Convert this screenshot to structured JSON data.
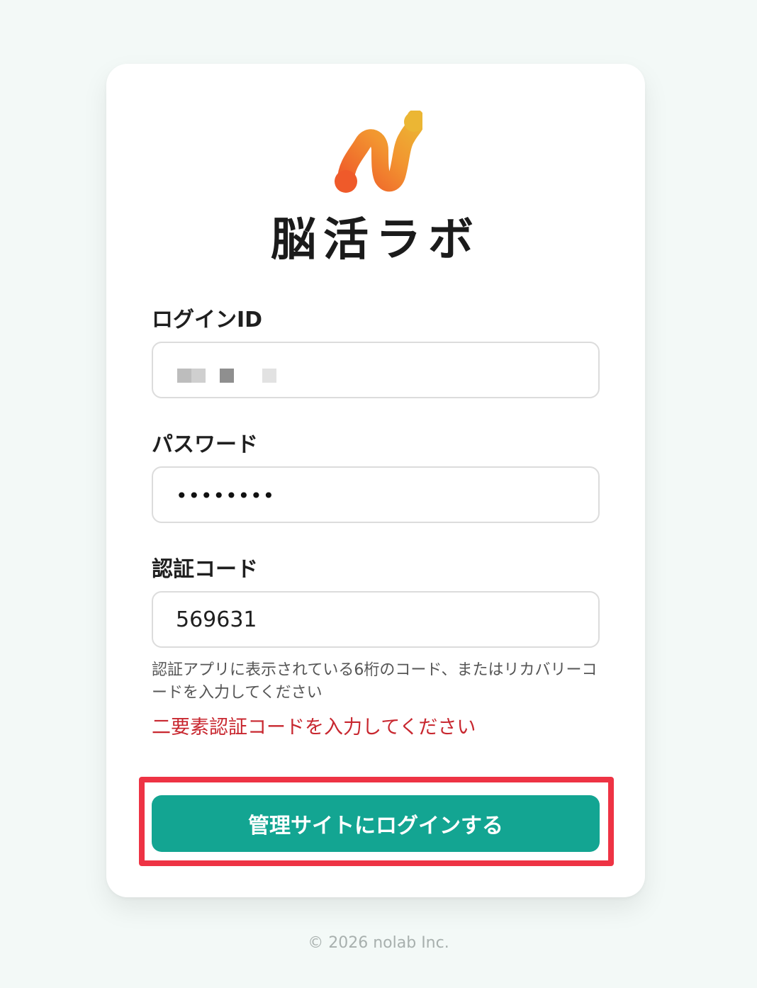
{
  "brand": {
    "name": "脳活ラボ",
    "logo_icon": "brand-swirl-icon",
    "colors": {
      "orange": "#ef5a2a",
      "amber": "#f29530",
      "yellow": "#ebb634"
    }
  },
  "form": {
    "login_id": {
      "label": "ログインID",
      "value": ""
    },
    "password": {
      "label": "パスワード",
      "masked_value": "••••••••"
    },
    "auth_code": {
      "label": "認証コード",
      "value": "569631"
    },
    "help_text": "認証アプリに表示されている6桁のコード、またはリカバリーコードを入力してください",
    "error_text": "二要素認証コードを入力してください",
    "submit_label": "管理サイトにログインする"
  },
  "footer": {
    "copyright": "© 2026 nolab Inc."
  },
  "colors": {
    "accent": "#13a592",
    "error": "#c8272f",
    "highlight": "#ee3344",
    "background": "#f3f9f7"
  }
}
